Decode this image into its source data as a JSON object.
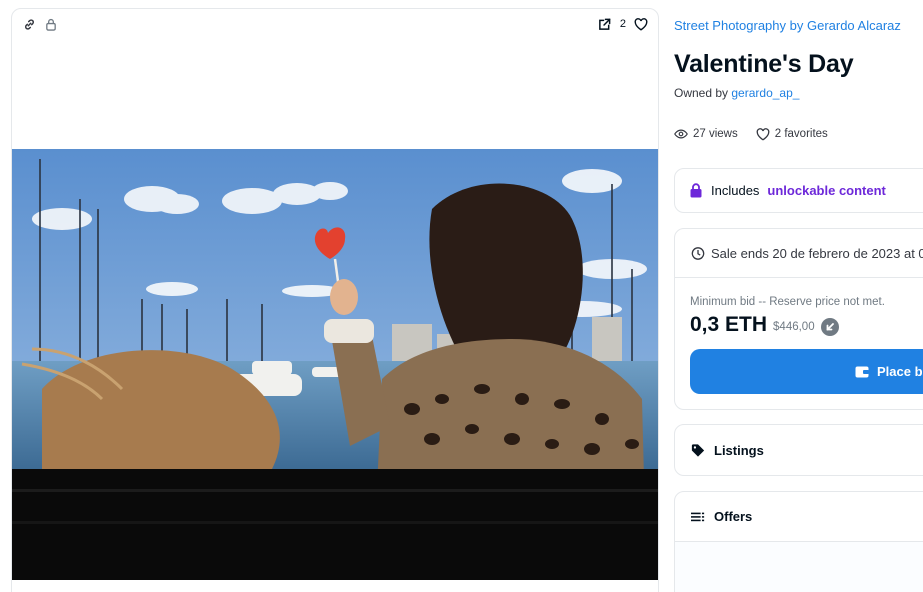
{
  "media": {
    "favorite_count": "2",
    "icons": [
      "link-icon",
      "lock-icon",
      "external-link-icon",
      "heart-icon"
    ]
  },
  "item": {
    "collection": "Street Photography by Gerardo Alcaraz",
    "title": "Valentine's Day",
    "owned_by_label": "Owned by",
    "owner": "gerardo_ap_",
    "views": "27 views",
    "favorites": "2 favorites"
  },
  "unlockable": {
    "prefix": "Includes",
    "highlight": "unlockable content"
  },
  "sale": {
    "ends_text": "Sale ends 20 de febrero de 2023 at 0",
    "min_bid_text": "Minimum bid -- Reserve price not met.",
    "price": "0,3 ETH",
    "fiat": "$446,00",
    "place_bid_label": "Place b"
  },
  "panels": {
    "listings_label": "Listings",
    "offers_label": "Offers"
  },
  "colors": {
    "accent": "#2081e2",
    "unlockable": "#6d28d9",
    "text": "#04111d",
    "muted": "#707a83",
    "border": "#e5e8eb"
  }
}
